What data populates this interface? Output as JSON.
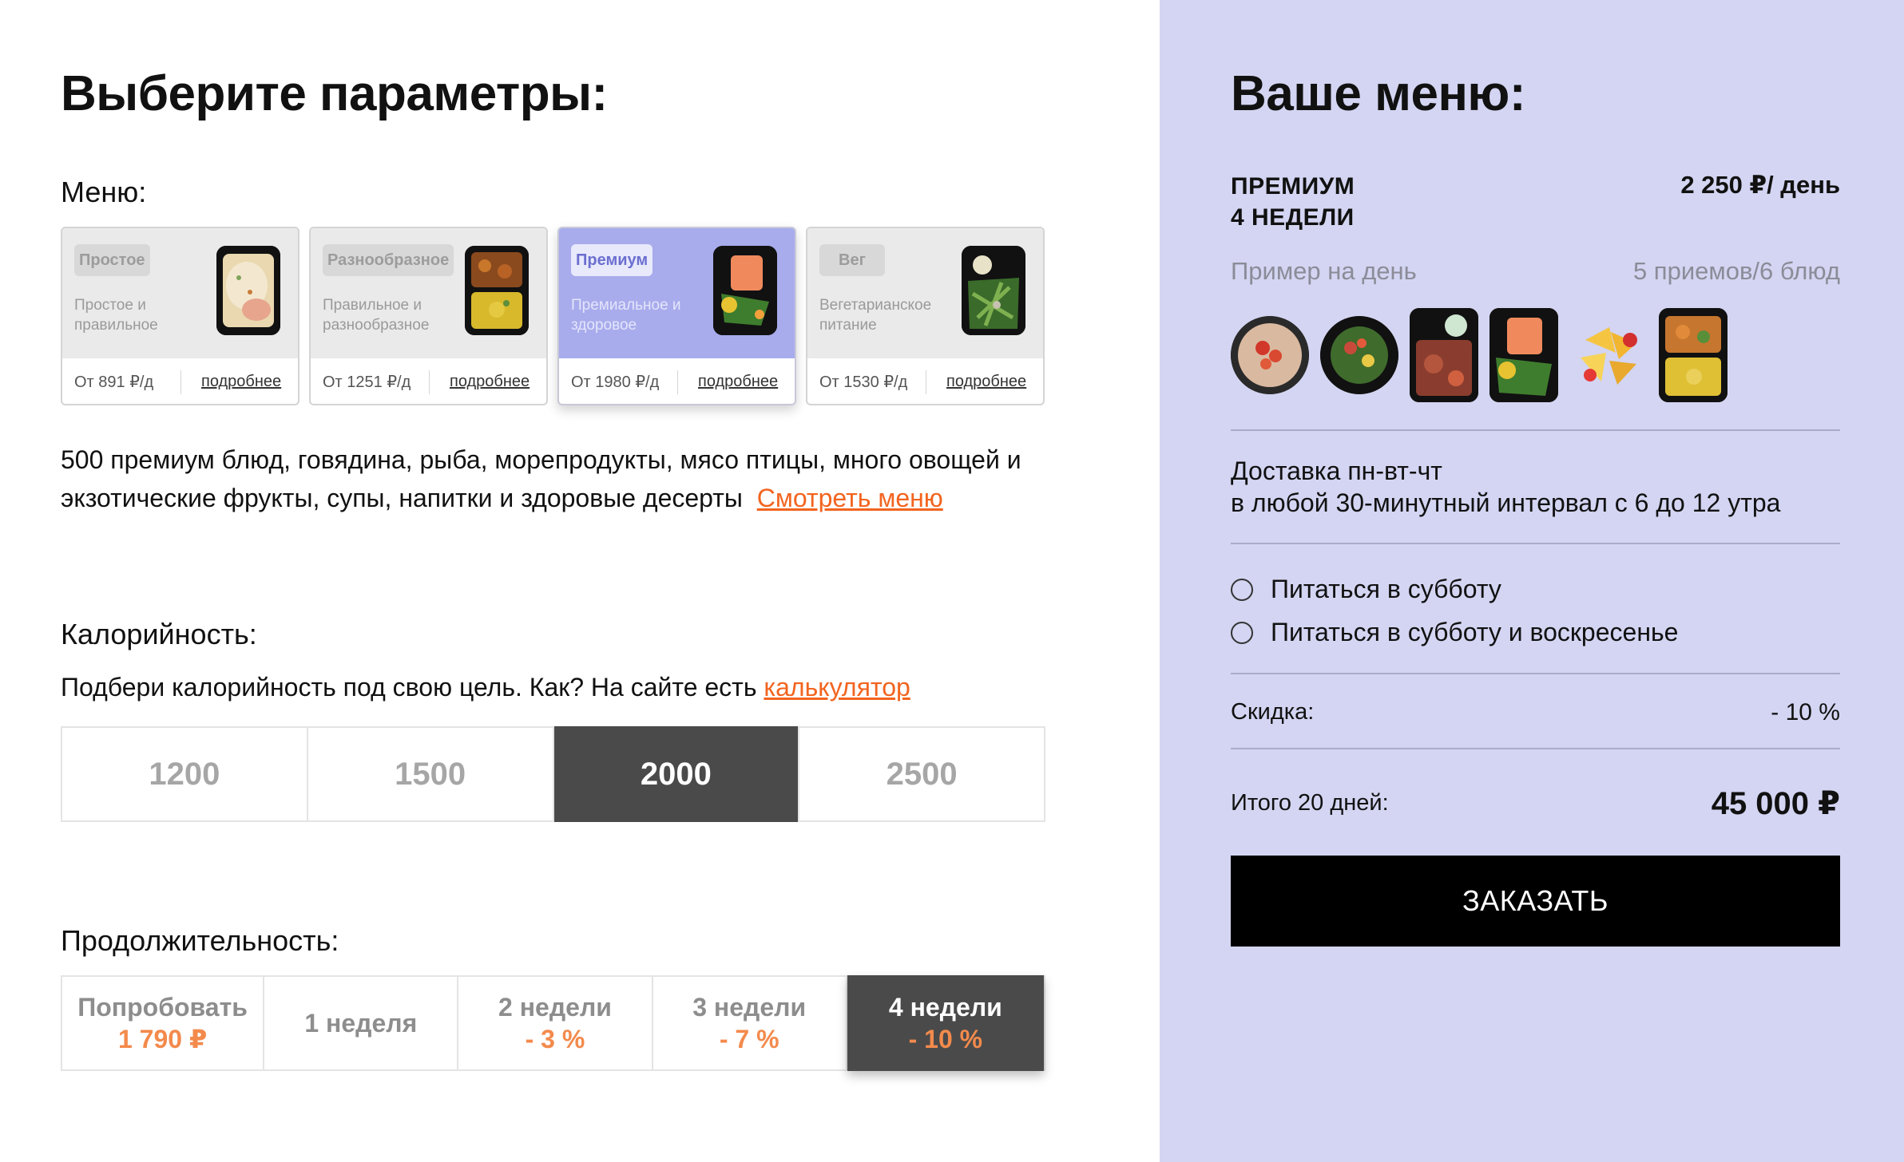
{
  "left": {
    "title": "Выберите параметры:",
    "menu_label": "Меню:",
    "cards": [
      {
        "badge": "Простое",
        "desc": "Простое и правильное",
        "price": "От 891 ₽/д",
        "more": "подробнее"
      },
      {
        "badge": "Разнообразное",
        "desc": "Правильное и разнообразное",
        "price": "От 1251 ₽/д",
        "more": "подробнее"
      },
      {
        "badge": "Премиум",
        "desc": "Премиальное и здоровое",
        "price": "От 1980 ₽/д",
        "more": "подробнее"
      },
      {
        "badge": "Вег",
        "desc": "Вегетарианское питание",
        "price": "От 1530 ₽/д",
        "more": "подробнее"
      }
    ],
    "menu_description": "500 премиум блюд, говядина, рыба, морепродукты, мясо птицы, много овощей и экзотические фрукты, супы, напитки и здоровые десерты",
    "menu_link": "Смотреть меню",
    "calories_label": "Калорийность:",
    "calories_hint": "Подбери калорийность под свою цель. Как? На сайте есть",
    "calories_link": "калькулятор",
    "calories_options": [
      "1200",
      "1500",
      "2000",
      "2500"
    ],
    "calories_selected": "2000",
    "duration_label": "Продолжительность:",
    "duration_options": [
      {
        "label": "Попробовать",
        "sub": "1 790 ₽"
      },
      {
        "label": "1 неделя",
        "sub": ""
      },
      {
        "label": "2 недели",
        "sub": "- 3 %"
      },
      {
        "label": "3 недели",
        "sub": "- 7 %"
      },
      {
        "label": "4 недели",
        "sub": "- 10 %"
      }
    ],
    "duration_selected": "4 недели"
  },
  "right": {
    "title": "Ваше меню:",
    "plan_line1": "ПРЕМИУМ",
    "plan_line2": "4 НЕДЕЛИ",
    "plan_price": "2 250 ₽/ день",
    "example_label": "Пример на день",
    "meals_label": "5 приемов/6 блюд",
    "delivery_line1": "Доставка пн-вт-чт",
    "delivery_line2": "в любой 30-минутный интервал с 6 до 12 утра",
    "option_saturday": "Питаться в субботу",
    "option_weekend": "Питаться в субботу и воскресенье",
    "discount_label": "Скидка:",
    "discount_value": "- 10 %",
    "total_label": "Итого 20 дней:",
    "total_value": "45 000 ₽",
    "order_button": "ЗАКАЗАТЬ"
  },
  "colors": {
    "accent": "#f2641f",
    "panel_bg": "#d3d5f2",
    "selected_bg": "#4a4a4a",
    "premium_card": "#a8acec"
  },
  "icons": [
    "radio-icon",
    "food-photo"
  ]
}
